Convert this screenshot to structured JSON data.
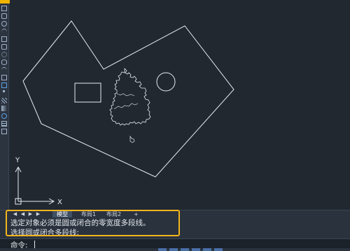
{
  "window": {
    "app": "CAD"
  },
  "toolbar": {
    "icons": [
      "line-icon",
      "polyline-icon",
      "circle-icon",
      "arc-icon",
      "rectangle-icon",
      "polygon-icon",
      "cloud-icon",
      "ellipse-icon",
      "ellipse-arc-icon",
      "insert-block-icon",
      "make-block-icon",
      "point-icon",
      "hatch-icon",
      "gradient-icon",
      "region-icon",
      "table-icon",
      "mtext-icon"
    ]
  },
  "tabs": {
    "nav": [
      "◀",
      "◀",
      "▶",
      "▶"
    ],
    "model": "模型",
    "layout1": "布局1",
    "layout2": "布局2",
    "add": "+"
  },
  "ucs": {
    "x_label": "X",
    "y_label": "Y"
  },
  "command": {
    "history": [
      "选定对象必须是圆或闭合的零宽度多段线。",
      "选择圆或闭合多段线:"
    ],
    "prompt": "命令:"
  },
  "colors": {
    "background": "#212830",
    "highlight": "#f2b51e",
    "geometry": "#ffffff"
  }
}
